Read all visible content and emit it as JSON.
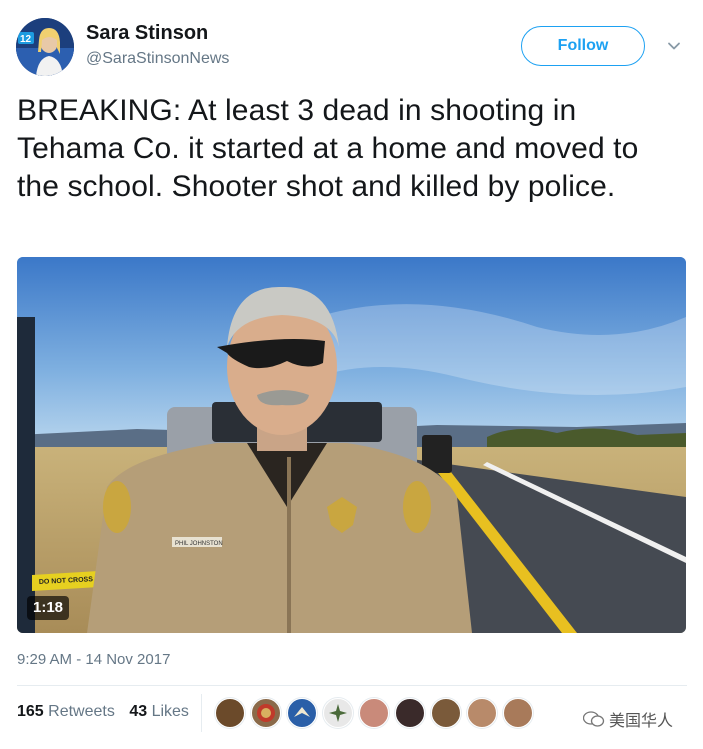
{
  "author": {
    "name": "Sara Stinson",
    "handle": "@SaraStinsonNews",
    "avatar_badge": "12"
  },
  "follow_button": {
    "label": "Follow"
  },
  "tweet": {
    "text": "BREAKING: At least 3 dead in shooting in Tehama Co. it started at a home and moved to the school. Shooter shot and killed by police.",
    "timestamp": "9:29 AM - 14 Nov 2017"
  },
  "video": {
    "duration": "1:18",
    "tape_text": "DO NOT CROSS",
    "name_tag": "PHIL JOHNSTON"
  },
  "stats": {
    "retweets_count": "165",
    "retweets_label": "Retweets",
    "likes_count": "43",
    "likes_label": "Likes"
  },
  "watermark": {
    "text": "美国华人"
  },
  "colors": {
    "accent": "#1da1f2",
    "text_primary": "#14171a",
    "text_secondary": "#657786",
    "divider": "#e6ecf0"
  }
}
